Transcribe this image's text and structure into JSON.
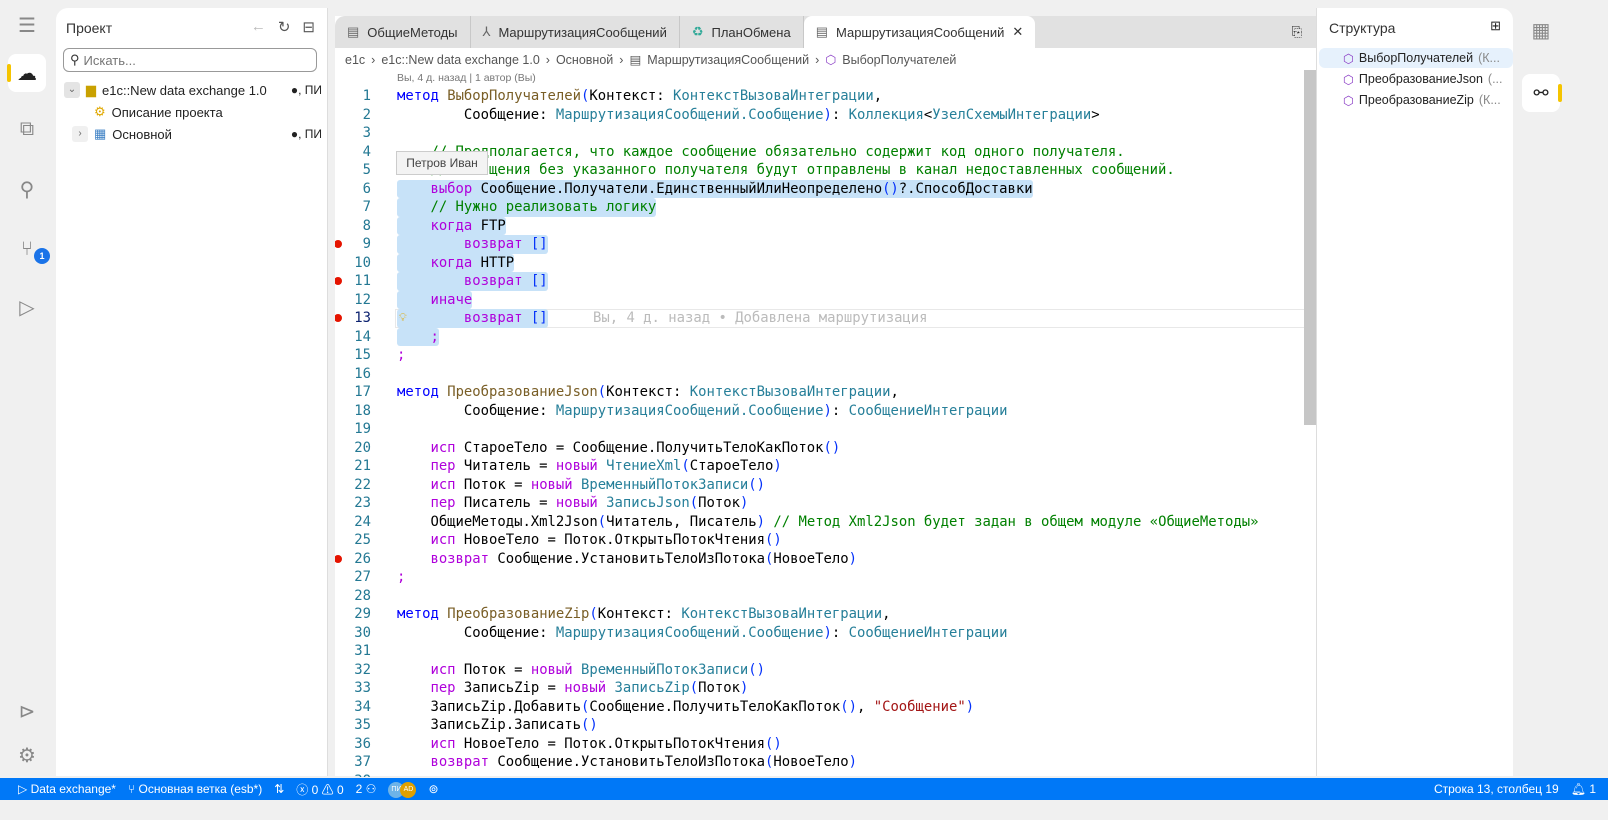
{
  "colors": {
    "accent": "#0078f7",
    "highlight": "#f5c400",
    "selection": "#c7e2f8",
    "breakpoint": "#e51400"
  },
  "activity": {
    "items": [
      {
        "icon": "menu-icon"
      },
      {
        "icon": "cloud-1c-icon"
      },
      {
        "icon": "files-icon"
      },
      {
        "icon": "search-icon"
      },
      {
        "icon": "source-control-icon",
        "badge": "1"
      },
      {
        "icon": "run-debug-icon"
      },
      {
        "icon": "run-all-icon"
      },
      {
        "icon": "settings-gear-icon"
      }
    ]
  },
  "project": {
    "title": "Проект",
    "search_placeholder": "Искать...",
    "tree": [
      {
        "label": "e1c::New data exchange 1.0",
        "status": "●, ПИ"
      },
      {
        "label": "Описание проекта",
        "status": ""
      },
      {
        "label": "Основной",
        "status": "●, ПИ"
      }
    ]
  },
  "tabs": [
    {
      "label": "ОбщиеМетоды"
    },
    {
      "label": "МаршрутизацияСообщений"
    },
    {
      "label": "ПланОбмена"
    },
    {
      "label": "МаршрутизацияСообщений",
      "active": true
    }
  ],
  "breadcrumbs": [
    "e1c",
    "e1c::New data exchange 1.0",
    "Основной",
    "МаршрутизацияСообщений",
    "ВыборПолучателей"
  ],
  "blame_header": "Вы, 4 д. назад | 1 автор (Вы)",
  "tooltip": "Петров Иван",
  "inline_blame": "Вы, 4 д. назад • Добавлена маршрутизация",
  "cursor": {
    "line": 13
  },
  "breakpoints": [
    9,
    11,
    13,
    26
  ],
  "selection_lines": [
    6,
    14
  ],
  "code": [
    [
      [
        "k1",
        "метод"
      ],
      [
        "i",
        " "
      ],
      [
        "f",
        "ВыборПолучателей"
      ],
      [
        "p",
        "("
      ],
      [
        "i",
        "Контекст: "
      ],
      [
        "t",
        "КонтекстВызоваИнтеграции"
      ],
      [
        "i",
        ","
      ]
    ],
    [
      [
        "i",
        "        Сообщение: "
      ],
      [
        "t",
        "МаршрутизацияСообщений.Сообщение"
      ],
      [
        "p",
        ")"
      ],
      [
        "i",
        ": "
      ],
      [
        "t",
        "Коллекция"
      ],
      [
        "i",
        "<"
      ],
      [
        "t",
        "УзелСхемыИнтеграции"
      ],
      [
        "i",
        ">"
      ]
    ],
    [],
    [
      [
        "i",
        "    "
      ],
      [
        "c",
        "// Предполагается, что каждое сообщение обязательно содержит код одного получателя."
      ]
    ],
    [
      [
        "i",
        "    "
      ],
      [
        "c",
        "// Сообщения без указанного получателя будут отправлены в канал недоставленных сообщений."
      ]
    ],
    [
      [
        "i",
        "    "
      ],
      [
        "k",
        "выбор"
      ],
      [
        "i",
        " Сообщение.Получатели.ЕдинственныйИлиНеопределено"
      ],
      [
        "p",
        "()"
      ],
      [
        "i",
        "?.СпособДоставки"
      ]
    ],
    [
      [
        "i",
        "    "
      ],
      [
        "c",
        "// Нужно реализовать логику"
      ]
    ],
    [
      [
        "i",
        "    "
      ],
      [
        "k",
        "когда"
      ],
      [
        "i",
        " FTP"
      ]
    ],
    [
      [
        "i",
        "        "
      ],
      [
        "k",
        "возврат"
      ],
      [
        "i",
        " "
      ],
      [
        "p",
        "[]"
      ]
    ],
    [
      [
        "i",
        "    "
      ],
      [
        "k",
        "когда"
      ],
      [
        "i",
        " HTTP"
      ]
    ],
    [
      [
        "i",
        "        "
      ],
      [
        "k",
        "возврат"
      ],
      [
        "i",
        " "
      ],
      [
        "p",
        "[]"
      ]
    ],
    [
      [
        "i",
        "    "
      ],
      [
        "k",
        "иначе"
      ]
    ],
    [
      [
        "i",
        "        "
      ],
      [
        "k",
        "возврат"
      ],
      [
        "i",
        " "
      ],
      [
        "p",
        "[]"
      ]
    ],
    [
      [
        "i",
        "    "
      ],
      [
        "k",
        ";"
      ]
    ],
    [
      [
        "k",
        ";"
      ]
    ],
    [],
    [
      [
        "k1",
        "метод"
      ],
      [
        "i",
        " "
      ],
      [
        "f",
        "ПреобразованиеJson"
      ],
      [
        "p",
        "("
      ],
      [
        "i",
        "Контекст: "
      ],
      [
        "t",
        "КонтекстВызоваИнтеграции"
      ],
      [
        "i",
        ","
      ]
    ],
    [
      [
        "i",
        "        Сообщение: "
      ],
      [
        "t",
        "МаршрутизацияСообщений.Сообщение"
      ],
      [
        "p",
        ")"
      ],
      [
        "i",
        ": "
      ],
      [
        "t",
        "СообщениеИнтеграции"
      ]
    ],
    [],
    [
      [
        "i",
        "    "
      ],
      [
        "k",
        "исп"
      ],
      [
        "i",
        " СтароеТело = Сообщение.ПолучитьТелоКакПоток"
      ],
      [
        "p",
        "()"
      ]
    ],
    [
      [
        "i",
        "    "
      ],
      [
        "k",
        "пер"
      ],
      [
        "i",
        " Читатель = "
      ],
      [
        "k",
        "новый"
      ],
      [
        "i",
        " "
      ],
      [
        "t",
        "ЧтениеXml"
      ],
      [
        "p",
        "("
      ],
      [
        "i",
        "СтароеТело"
      ],
      [
        "p",
        ")"
      ]
    ],
    [
      [
        "i",
        "    "
      ],
      [
        "k",
        "исп"
      ],
      [
        "i",
        " Поток = "
      ],
      [
        "k",
        "новый"
      ],
      [
        "i",
        " "
      ],
      [
        "t",
        "ВременныйПотокЗаписи"
      ],
      [
        "p",
        "()"
      ]
    ],
    [
      [
        "i",
        "    "
      ],
      [
        "k",
        "пер"
      ],
      [
        "i",
        " Писатель = "
      ],
      [
        "k",
        "новый"
      ],
      [
        "i",
        " "
      ],
      [
        "t",
        "ЗаписьJson"
      ],
      [
        "p",
        "("
      ],
      [
        "i",
        "Поток"
      ],
      [
        "p",
        ")"
      ]
    ],
    [
      [
        "i",
        "    ОбщиеМетоды.Xml2Json"
      ],
      [
        "p",
        "("
      ],
      [
        "i",
        "Читатель, Писатель"
      ],
      [
        "p",
        ")"
      ],
      [
        "i",
        " "
      ],
      [
        "c",
        "// Метод Xml2Json будет задан в общем модуле «ОбщиеМетоды»"
      ]
    ],
    [
      [
        "i",
        "    "
      ],
      [
        "k",
        "исп"
      ],
      [
        "i",
        " НовоеТело = Поток.ОткрытьПотокЧтения"
      ],
      [
        "p",
        "()"
      ]
    ],
    [
      [
        "i",
        "    "
      ],
      [
        "k",
        "возврат"
      ],
      [
        "i",
        " Сообщение.УстановитьТелоИзПотока"
      ],
      [
        "p",
        "("
      ],
      [
        "i",
        "НовоеТело"
      ],
      [
        "p",
        ")"
      ]
    ],
    [
      [
        "k",
        ";"
      ]
    ],
    [],
    [
      [
        "k1",
        "метод"
      ],
      [
        "i",
        " "
      ],
      [
        "f",
        "ПреобразованиеZip"
      ],
      [
        "p",
        "("
      ],
      [
        "i",
        "Контекст: "
      ],
      [
        "t",
        "КонтекстВызоваИнтеграции"
      ],
      [
        "i",
        ","
      ]
    ],
    [
      [
        "i",
        "        Сообщение: "
      ],
      [
        "t",
        "МаршрутизацияСообщений.Сообщение"
      ],
      [
        "p",
        ")"
      ],
      [
        "i",
        ": "
      ],
      [
        "t",
        "СообщениеИнтеграции"
      ]
    ],
    [],
    [
      [
        "i",
        "    "
      ],
      [
        "k",
        "исп"
      ],
      [
        "i",
        " Поток = "
      ],
      [
        "k",
        "новый"
      ],
      [
        "i",
        " "
      ],
      [
        "t",
        "ВременныйПотокЗаписи"
      ],
      [
        "p",
        "()"
      ]
    ],
    [
      [
        "i",
        "    "
      ],
      [
        "k",
        "пер"
      ],
      [
        "i",
        " ЗаписьZip = "
      ],
      [
        "k",
        "новый"
      ],
      [
        "i",
        " "
      ],
      [
        "t",
        "ЗаписьZip"
      ],
      [
        "p",
        "("
      ],
      [
        "i",
        "Поток"
      ],
      [
        "p",
        ")"
      ]
    ],
    [
      [
        "i",
        "    ЗаписьZip.Добавить"
      ],
      [
        "p",
        "("
      ],
      [
        "i",
        "Сообщение.ПолучитьТелоКакПоток"
      ],
      [
        "p",
        "()"
      ],
      [
        "i",
        ", "
      ],
      [
        "s",
        "\"Сообщение\""
      ],
      [
        "p",
        ")"
      ]
    ],
    [
      [
        "i",
        "    ЗаписьZip.Записать"
      ],
      [
        "p",
        "()"
      ]
    ],
    [
      [
        "i",
        "    "
      ],
      [
        "k",
        "исп"
      ],
      [
        "i",
        " НовоеТело = Поток.ОткрытьПотокЧтения"
      ],
      [
        "p",
        "()"
      ]
    ],
    [
      [
        "i",
        "    "
      ],
      [
        "k",
        "возврат"
      ],
      [
        "i",
        " Сообщение.УстановитьТелоИзПотока"
      ],
      [
        "p",
        "("
      ],
      [
        "i",
        "НовоеТело"
      ],
      [
        "p",
        ")"
      ]
    ],
    []
  ],
  "structure": {
    "title": "Структура",
    "items": [
      {
        "name": "ВыборПолучателей",
        "detail": "(К..."
      },
      {
        "name": "ПреобразованиеJson",
        "detail": "(..."
      },
      {
        "name": "ПреобразованиеZip",
        "detail": "(К..."
      }
    ]
  },
  "status": {
    "project": "Data exchange*",
    "branch": "Основная ветка (esb*)",
    "errors": "0",
    "warnings": "0",
    "participants": "2",
    "avatars": [
      "ПИ",
      "AD"
    ],
    "position": "Строка 13, столбец 19",
    "notifications": "1"
  }
}
